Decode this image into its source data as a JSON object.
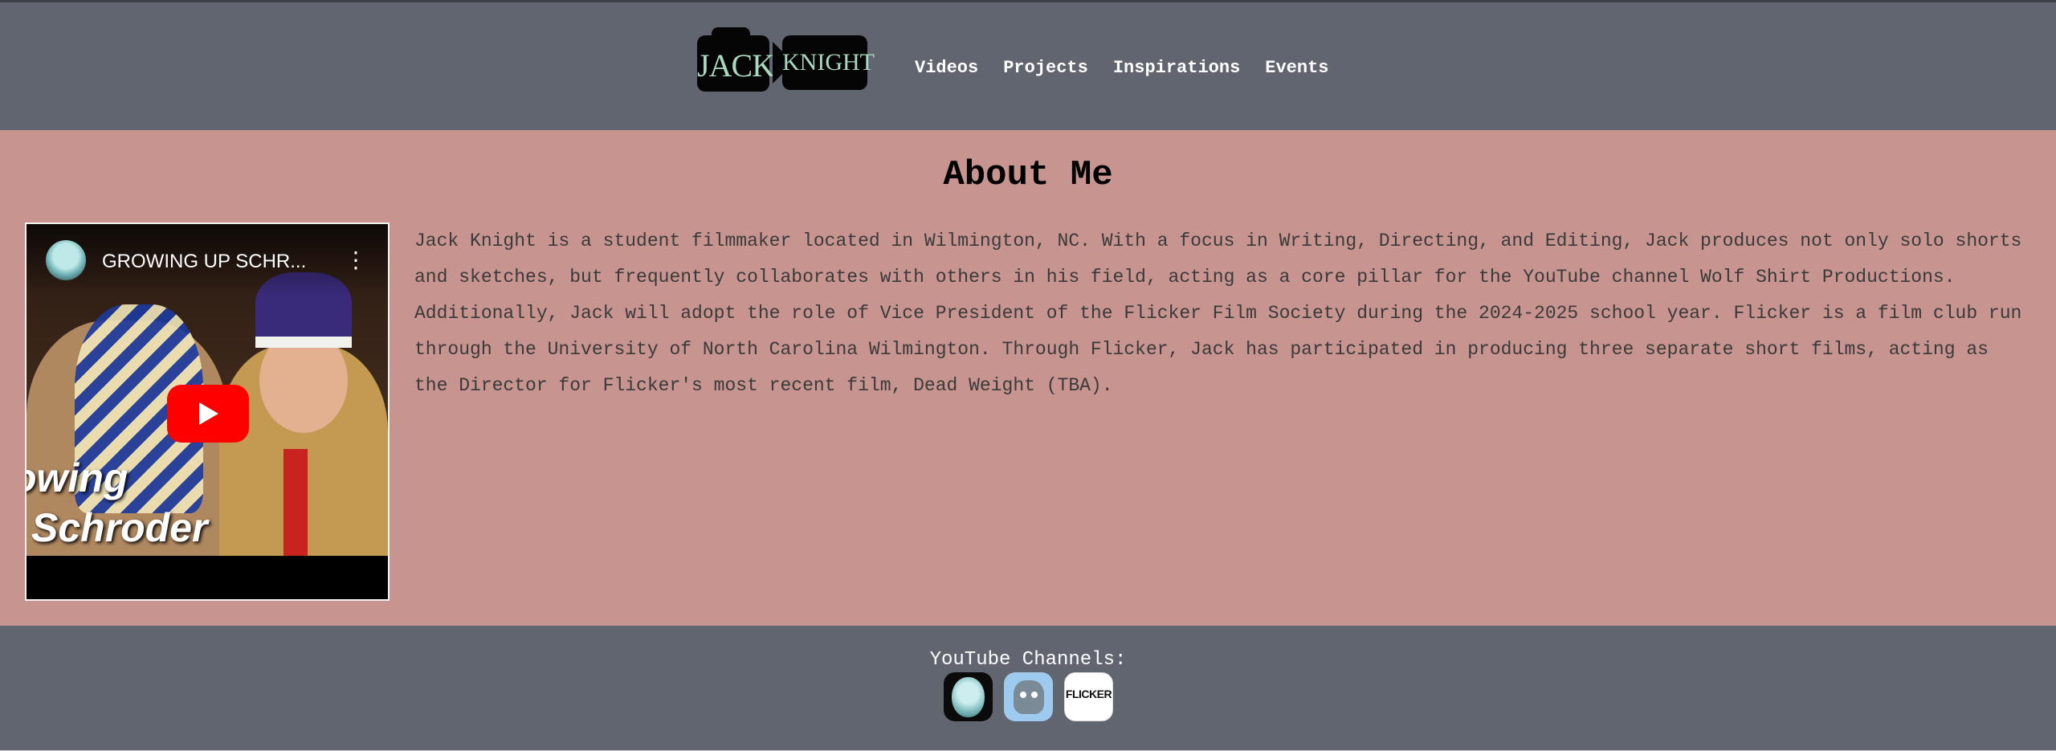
{
  "header": {
    "logo": {
      "left_word": "JACK",
      "right_word": "KNIGHT"
    },
    "nav": [
      {
        "label": "Videos"
      },
      {
        "label": "Projects"
      },
      {
        "label": "Inspirations"
      },
      {
        "label": "Events"
      }
    ]
  },
  "main": {
    "heading": "About Me",
    "video": {
      "title": "GROWING UP SCHR...",
      "overlay_line1": "owing",
      "overlay_line2": "Schroder",
      "menu_icon": "kebab-menu-icon",
      "play_icon": "youtube-play-icon"
    },
    "about_text": "Jack Knight is a student filmmaker located in Wilmington, NC. With a focus in Writing, Directing, and Editing, Jack produces not only solo shorts and sketches, but frequently collaborates with others in his field, acting as a core pillar for the YouTube channel Wolf Shirt Productions. Additionally, Jack will adopt the role of Vice President of the Flicker Film Society during the 2024-2025 school year. Flicker is a film club run through the University of North Carolina Wilmington. Through Flicker, Jack has participated in producing three separate short films, acting as the Director for Flicker's most recent film, Dead Weight (TBA)."
  },
  "footer": {
    "label": "YouTube Channels:",
    "channels": [
      {
        "icon": "hockey-mask-channel-icon"
      },
      {
        "icon": "wolf-shirt-channel-icon"
      },
      {
        "icon": "flicker-channel-icon",
        "text": "FLICKER"
      }
    ]
  },
  "colors": {
    "header_bg": "#606570",
    "body_bg": "#c7948f",
    "logo_text": "#a8d8c0",
    "play_button": "#ff0000"
  }
}
